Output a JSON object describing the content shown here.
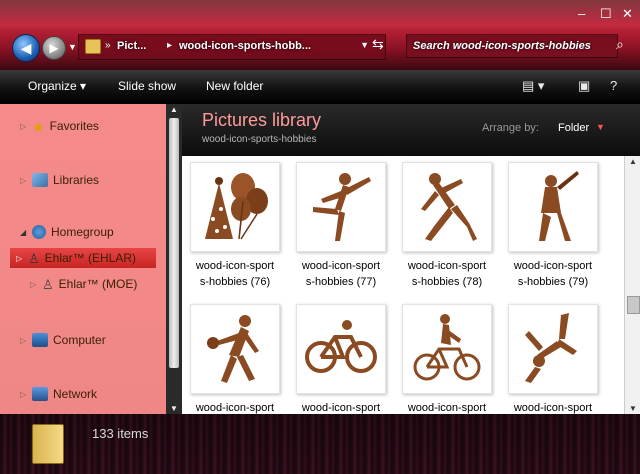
{
  "address": {
    "crumbs": [
      "Pict...",
      "wood-icon-sports-hobb..."
    ]
  },
  "search": {
    "placeholder": "Search wood-icon-sports-hobbies"
  },
  "toolbar": {
    "organize": "Organize",
    "slideshow": "Slide show",
    "new_folder": "New folder"
  },
  "sidebar": {
    "favorites": "Favorites",
    "libraries": "Libraries",
    "homegroup": "Homegroup",
    "user1": "Ehlar™ (EHLAR)",
    "user2": "Ehlar™ (MOE)",
    "computer": "Computer",
    "network": "Network"
  },
  "library": {
    "title": "Pictures library",
    "subtitle": "wood-icon-sports-hobbies",
    "arrange_label": "Arrange by:",
    "arrange_value": "Folder"
  },
  "files": [
    {
      "line1": "wood-icon-sport",
      "line2": "s-hobbies (76)",
      "icon": "party-balloons-icon"
    },
    {
      "line1": "wood-icon-sport",
      "line2": "s-hobbies (77)",
      "icon": "ballet-dancer-icon"
    },
    {
      "line1": "wood-icon-sport",
      "line2": "s-hobbies (78)",
      "icon": "baseball-pitcher-icon"
    },
    {
      "line1": "wood-icon-sport",
      "line2": "s-hobbies (79)",
      "icon": "baseball-batter-icon"
    },
    {
      "line1": "wood-icon-sport",
      "line2": "",
      "icon": "basketball-player-icon"
    },
    {
      "line1": "wood-icon-sport",
      "line2": "",
      "icon": "cycling-icon"
    },
    {
      "line1": "wood-icon-sport",
      "line2": "",
      "icon": "bicycle-rider-icon"
    },
    {
      "line1": "wood-icon-sport",
      "line2": "",
      "icon": "breakdancer-icon"
    }
  ],
  "status": {
    "count": "133 items"
  },
  "colors": {
    "wood": "#8a4a22",
    "accent": "#c2243a",
    "sidebar": "#f58a8a"
  }
}
